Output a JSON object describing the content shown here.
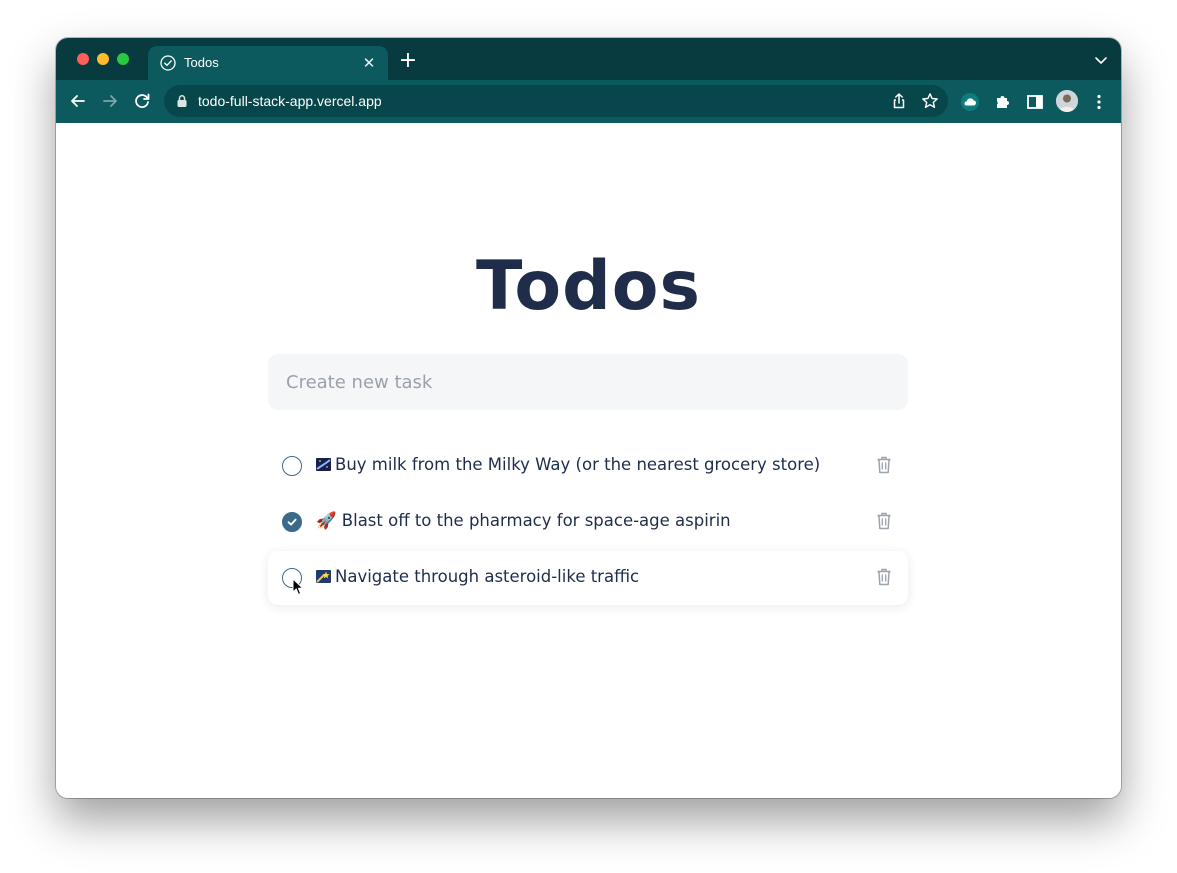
{
  "browser": {
    "tab_title": "Todos",
    "url": "todo-full-stack-app.vercel.app",
    "colors": {
      "tabstrip": "#073b40",
      "toolbar": "#0c5a5e",
      "omnibox": "#07474b"
    }
  },
  "app": {
    "title": "Todos",
    "input_placeholder": "Create new task",
    "accent": "#3e6a8a",
    "text_color": "#1f2d4b",
    "todos": [
      {
        "emoji_icon": "milky-way-icon",
        "text": "Buy milk from the Milky Way (or the nearest grocery store)",
        "completed": false
      },
      {
        "emoji_icon": "rocket-icon",
        "text": "🚀 Blast off to the pharmacy for space-age aspirin",
        "completed": true
      },
      {
        "emoji_icon": "shooting-star-icon",
        "text": "Navigate through asteroid-like traffic",
        "completed": false
      }
    ]
  }
}
